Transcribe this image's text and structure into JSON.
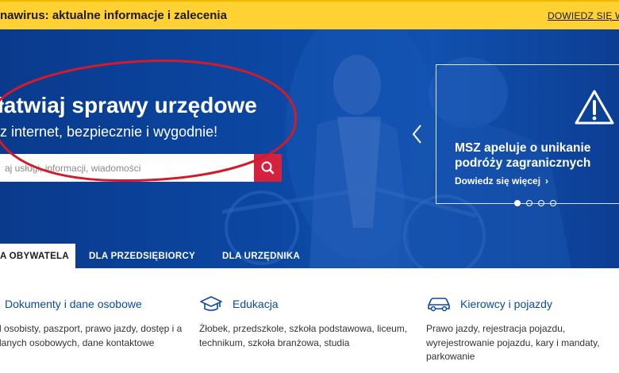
{
  "banner": {
    "text": "nawirus: aktualne informacje i zalecenia",
    "link": "DOWIEDZ SIĘ WI"
  },
  "hero": {
    "title": "łatwiaj sprawy urzędowe",
    "subtitle": "z internet, bezpiecznie i wygodnie!",
    "search_placeholder": "aj usługi, informacji, wiadomości"
  },
  "carousel": {
    "title": "MSZ apeluje o unikanie podróży zagranicznych",
    "link": "Dowiedz się więcej",
    "arrow": "›",
    "slide_count": 4,
    "active_slide": 1
  },
  "tabs": [
    {
      "label": "A OBYWATELA",
      "active": true
    },
    {
      "label": "DLA PRZEDSIĘBIORCY",
      "active": false
    },
    {
      "label": "DLA URZĘDNIKA",
      "active": false
    }
  ],
  "categories": [
    {
      "title": "Dokumenty i dane osobowe",
      "desc": "d osobisty, paszport, prawo jazdy, dostęp i a danych osobowych, dane kontaktowe",
      "icon": "id-card-icon"
    },
    {
      "title": "Edukacja",
      "desc": "Żłobek, przedszkole, szkoła podstawowa, liceum, technikum, szkoła branżowa, studia",
      "icon": "graduation-cap-icon"
    },
    {
      "title": "Kierowcy i pojazdy",
      "desc": "Prawo jazdy, rejestracja pojazdu, wyrejestrowanie pojazdu, kary i mandaty, parkowanie",
      "icon": "car-icon"
    }
  ],
  "colors": {
    "banner": "#ffd132",
    "hero_blue": "#0b4aa6",
    "search_button": "#d4213d",
    "annotation_red": "#d11b2a",
    "link_blue": "#0b4aa6"
  }
}
